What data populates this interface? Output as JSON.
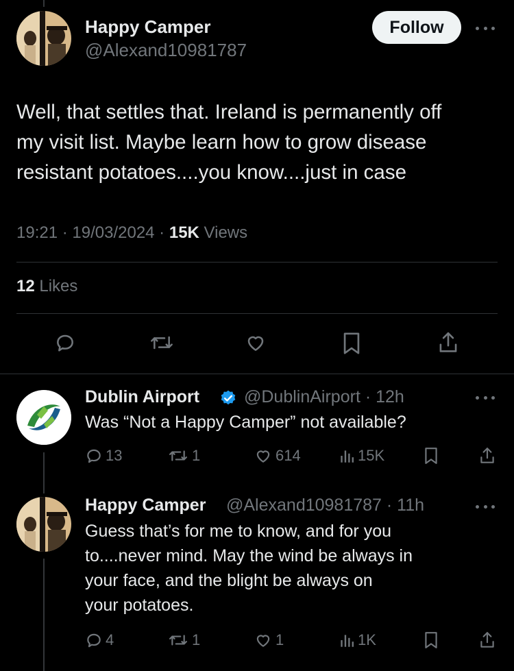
{
  "tweet": {
    "author_name": "Happy Camper",
    "author_handle": "@Alexand10981787",
    "follow_label": "Follow",
    "text_lines": [
      "Well, that settles that. Ireland is permanently off",
      "my visit list. Maybe learn how to grow disease",
      "resistant potatoes....you  know....just  in  case"
    ],
    "time": "19:21",
    "date": "19/03/2024",
    "views_count": "15K",
    "views_label": "Views",
    "likes_count": "12",
    "likes_label": "Likes",
    "icons": [
      "reply-icon",
      "retweet-icon",
      "like-icon",
      "bookmark-icon",
      "share-icon"
    ]
  },
  "replies": [
    {
      "author_name": "Dublin Airport",
      "verified": true,
      "author_handle": "@DublinAirport",
      "age": "12h",
      "text_lines": [
        "Was “Not a Happy Camper” not available?"
      ],
      "stats": {
        "replies": "13",
        "retweets": "1",
        "likes": "614",
        "views": "15K"
      }
    },
    {
      "author_name": "Happy Camper",
      "verified": false,
      "author_handle": "@Alexand10981787",
      "age": "11h",
      "text_lines": [
        "Guess that’s for me to know, and for you",
        "to....never  mind.  May  the  wind  be  always  in",
        "your face,  and  the  blight  be  always  on",
        "your  potatoes."
      ],
      "stats": {
        "replies": "4",
        "retweets": "1",
        "likes": "1",
        "views": "1K"
      }
    }
  ],
  "colors": {
    "background": "#000000",
    "text": "#e7e9ea",
    "muted": "#71767b",
    "divider": "#2f3336",
    "verified": "#1d9bf0",
    "follow_bg": "#eff3f4"
  }
}
